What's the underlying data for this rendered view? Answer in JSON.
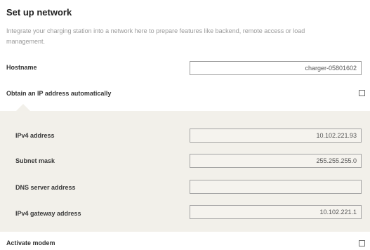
{
  "header": {
    "title": "Set up network",
    "description": "Integrate your charging station into a network here to prepare features like backend, remote access or load management."
  },
  "hostname": {
    "label": "Hostname",
    "value": "charger-05801602"
  },
  "obtain_ip": {
    "label": "Obtain an IP address automatically",
    "checked": false
  },
  "ip_settings": [
    {
      "label": "IPv4 address",
      "value": "10.102.221.93"
    },
    {
      "label": "Subnet mask",
      "value": "255.255.255.0"
    },
    {
      "label": "DNS server address",
      "value": ""
    },
    {
      "label": "IPv4 gateway address",
      "value": "10.102.221.1"
    }
  ],
  "modem": {
    "label": "Activate modem",
    "checked": false
  },
  "colors": {
    "panel_bg": "#f2f0ea",
    "input_border": "#9d9d9d"
  }
}
